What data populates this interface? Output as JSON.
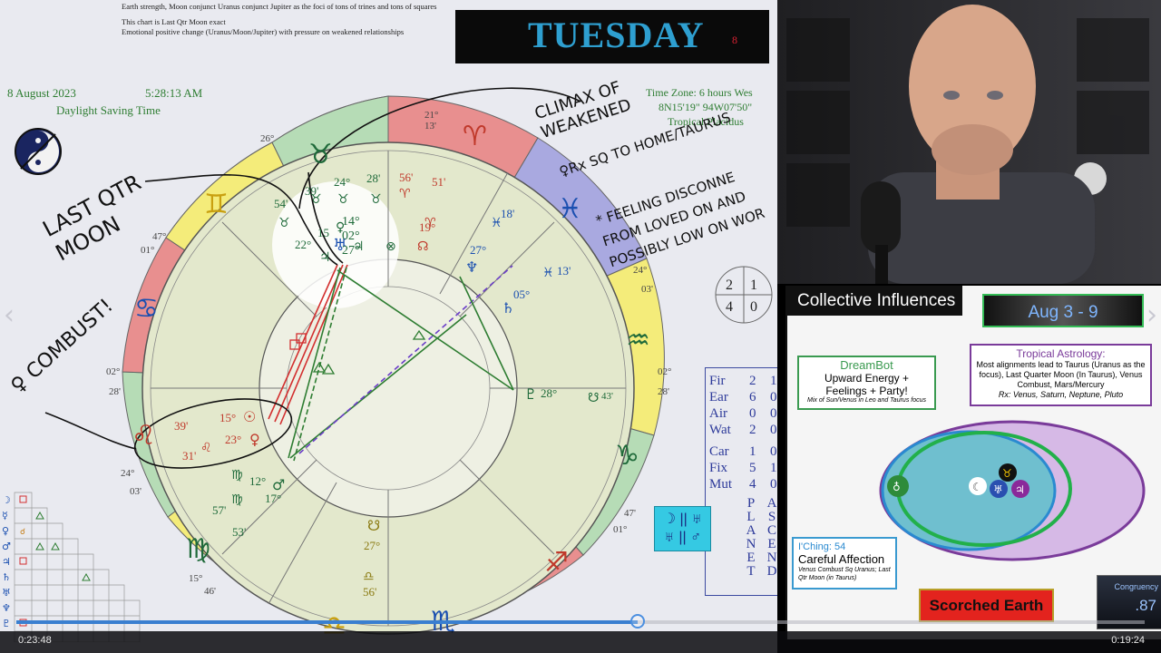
{
  "notes": [
    "Earth strength, Moon conjunct Uranus conjunct Jupiter as the foci of tons of trines and tons of squares",
    "This chart is Last Qtr Moon exact",
    "Emotional positive change (Uranus/Moon/Jupiter) with pressure on weakened relationships"
  ],
  "banner": {
    "day": "TUESDAY",
    "number": "8"
  },
  "chart_header": {
    "date": "8 August 2023",
    "time": "5:28:13 AM",
    "dst": "Daylight Saving Time",
    "timezone": "Time Zone: 6 hours Wes",
    "coords": "8N15'19\"  94W07'50\"",
    "system": "Tropical Placidus"
  },
  "handwriting": {
    "moon": "LAST QTR MOON",
    "climax": "CLIMAX OF WEAKENED",
    "venus_sq": "♀Rx SQ TO HOME/TAURUS",
    "feeling": "* FEELING DISCONNE FROM LOVED ON AND POSSIBLY LOW ON WOR",
    "combust": "♀ COMBUST!"
  },
  "grid4": [
    "2",
    "1",
    "4",
    "0"
  ],
  "elements": {
    "rows": [
      {
        "label": "Fir",
        "v": "2",
        "w": "1"
      },
      {
        "label": "Ear",
        "v": "6",
        "w": "0"
      },
      {
        "label": "Air",
        "v": "0",
        "w": "0"
      },
      {
        "label": "Wat",
        "v": "2",
        "w": "0"
      },
      {
        "label": "Car",
        "v": "1",
        "w": "0"
      },
      {
        "label": "Fix",
        "v": "5",
        "w": "1"
      },
      {
        "label": "Mut",
        "v": "4",
        "w": "0"
      }
    ],
    "planet_letters": "PLANET",
    "ahead_letters": "ASCEND"
  },
  "cyan_box": [
    "☽ || ♅",
    "♅ || ♂"
  ],
  "wheel": {
    "degrees": [
      "21° 13'",
      "26°",
      "47°",
      "01°",
      "02°",
      "28'",
      "24°",
      "03'",
      "15°",
      "46'",
      "24°",
      "03'",
      "02°",
      "28'",
      "47'",
      "01°"
    ],
    "planet_labels": [
      "39'",
      "28'",
      "56'",
      "51'",
      "24°",
      "54'",
      "19°",
      "14° 02° 27°",
      "22°",
      "15",
      "27°",
      "18'",
      "13'",
      "05°",
      "28°",
      "43'",
      "15°",
      "39'",
      "23°",
      "31'",
      "12°",
      "17°",
      "57'",
      "53'",
      "27°",
      "56'"
    ]
  },
  "progress": {
    "current": "0:23:48",
    "total": "0:19:24",
    "fraction": 0.551
  },
  "influences": {
    "title": "Collective Influences",
    "week": "Aug 3 - 9",
    "dreambot_title": "DreamBot",
    "dreambot_line1": "Upward Energy +",
    "dreambot_line2": "Feelings + Party!",
    "dreambot_note": "Mix of Sun/Venus in Leo and Taurus focus",
    "trop_title": "Tropical Astrology:",
    "trop_body": "Most alignments lead to Taurus (Uranus as the focus), Last Quarter Moon (In Taurus), Venus Combust, Mars/Mercury",
    "trop_rx": "Rx: Venus, Saturn, Neptune, Pluto",
    "iching_label": "I'Ching: 54",
    "iching_title": "Careful Affection",
    "iching_note": "Venus Combust Sq Uranus; Last Qtr Moon (in Taurus)",
    "scorched": "Scorched Earth",
    "congruency_label": "Congruency",
    "congruency_value": ".87"
  },
  "colors": {
    "green": "#2e7d32",
    "red": "#d32f2f",
    "blue": "#1a4fb0",
    "banner_text": "#2e9fd0"
  }
}
